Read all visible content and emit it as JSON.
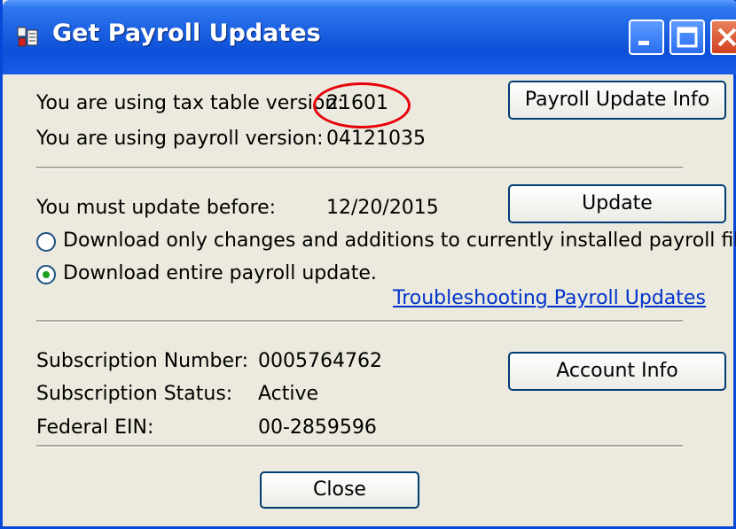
{
  "window": {
    "title": "Get Payroll Updates"
  },
  "tax_table": {
    "label": "You are using tax table version:",
    "value": "21601"
  },
  "payroll_version": {
    "label": "You are using payroll version:",
    "value": "04121035"
  },
  "buttons": {
    "payroll_update_info": "Payroll Update Info",
    "update": "Update",
    "account_info": "Account Info",
    "close": "Close"
  },
  "deadline": {
    "label": "You must update before:",
    "value": "12/20/2015"
  },
  "options": [
    {
      "label": "Download only changes and additions to currently installed payroll files.",
      "selected": false
    },
    {
      "label": "Download entire payroll update.",
      "selected": true
    }
  ],
  "troubleshooting_link": "Troubleshooting Payroll Updates",
  "subscription": {
    "number_label": "Subscription Number:",
    "number_value": "0005764762",
    "status_label": "Subscription Status:",
    "status_value": "Active",
    "ein_label": "Federal EIN:",
    "ein_value": "00-2859596"
  },
  "colors": {
    "titlebar": "#0c4fd8",
    "dialog_bg": "#eceade",
    "highlight": "#e8000b",
    "link": "#0033cc"
  },
  "icons": [
    "payroll-app-icon",
    "minimize-icon",
    "maximize-icon",
    "close-icon"
  ]
}
